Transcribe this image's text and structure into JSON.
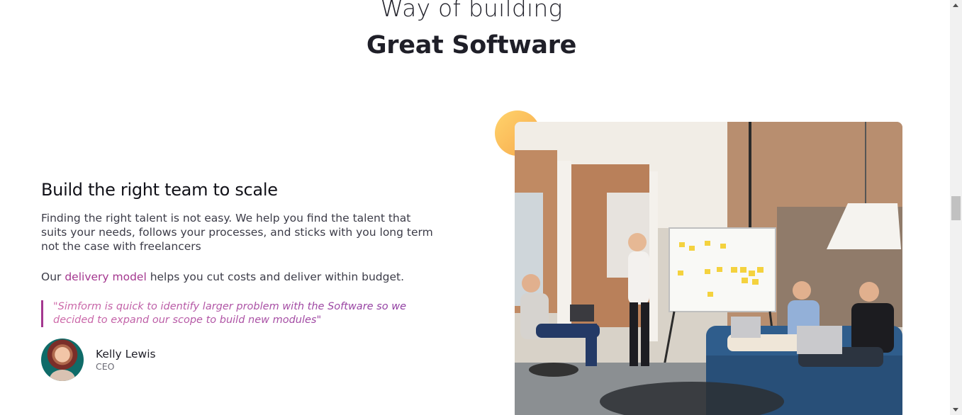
{
  "hero": {
    "line1": "Way of building",
    "line2": "Great Software"
  },
  "section": {
    "title": "Build the right team to scale",
    "description": "Finding the right talent is not easy. We help you find the talent that suits your needs, follows your processes, and sticks with you long term not the case with freelancers",
    "delivery_prefix": "Our ",
    "delivery_link": "delivery model",
    "delivery_suffix": " helps you cut costs and deliver within budget."
  },
  "testimonial": {
    "quote": "\"Simform is quick to identify larger problem with the Software so we decided to expand our scope to build new modules\"",
    "author_name": "Kelly Lewis",
    "author_role": "CEO"
  },
  "colors": {
    "accent": "#a4378f",
    "circle_accent": "#f7a94d"
  }
}
